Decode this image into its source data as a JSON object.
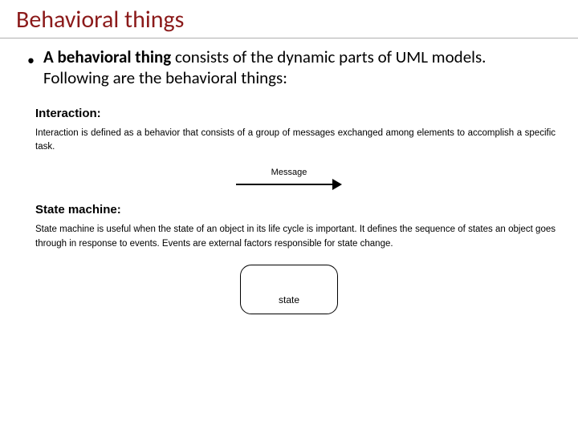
{
  "title": "Behavioral things",
  "bullet": {
    "bold": "A behavioral thing",
    "rest": " consists of the dynamic parts of UML models. Following are the behavioral things:"
  },
  "interaction": {
    "heading": "Interaction:",
    "body": "Interaction is defined as a behavior that consists of a group of messages exchanged among elements to accomplish a specific task.",
    "label": "Message"
  },
  "stateMachine": {
    "heading": "State machine:",
    "body": "State machine is useful when the state of an object in its life cycle is important. It defines the sequence of states an object goes through in response to events. Events are external factors responsible for state change.",
    "label": "state"
  }
}
